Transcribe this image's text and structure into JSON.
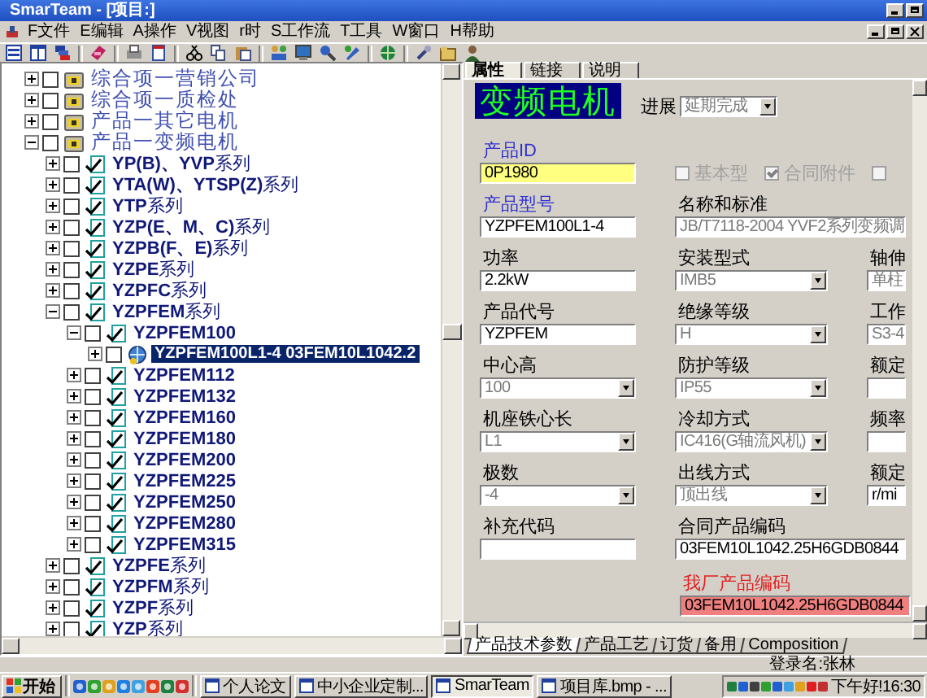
{
  "window": {
    "title": "SmarTeam - [项目:]"
  },
  "menu": [
    "F文件",
    "E编辑",
    "A操作",
    "V视图",
    "r时",
    "S工作流",
    "T工具",
    "W窗口",
    "H帮助"
  ],
  "tree": [
    {
      "kind": "group",
      "label": "综合项一营销公司",
      "expanded": false,
      "checked": false,
      "selected": false
    },
    {
      "kind": "group",
      "label": "综合项一质检处",
      "expanded": false,
      "checked": false,
      "selected": false
    },
    {
      "kind": "group",
      "label": "产品一其它电机",
      "expanded": false,
      "checked": false,
      "selected": false
    },
    {
      "kind": "group",
      "label": "产品一变频电机",
      "expanded": true,
      "checked": false,
      "selected": false,
      "children": [
        {
          "kind": "series",
          "label": "**YP(B)、YVP**系列",
          "expanded": false,
          "checked": false,
          "selected": false
        },
        {
          "kind": "series",
          "label": "**YTA(W)、YTSP(Z)**系列",
          "expanded": false,
          "checked": false,
          "selected": false
        },
        {
          "kind": "series",
          "label": "**YTP**系列",
          "expanded": false,
          "checked": false,
          "selected": false
        },
        {
          "kind": "series",
          "label": "**YZP(E、M、C)**系列",
          "expanded": false,
          "checked": false,
          "selected": false
        },
        {
          "kind": "series",
          "label": "**YZPB(F、E)**系列",
          "expanded": false,
          "checked": false,
          "selected": false
        },
        {
          "kind": "series",
          "label": "**YZPE**系列",
          "expanded": false,
          "checked": false,
          "selected": false
        },
        {
          "kind": "series",
          "label": "**YZPFC**系列",
          "expanded": false,
          "checked": false,
          "selected": false
        },
        {
          "kind": "series",
          "label": "**YZPFEM**系列",
          "expanded": true,
          "checked": false,
          "selected": false,
          "children": [
            {
              "kind": "model",
              "label": "YZPFEM100",
              "expanded": true,
              "checked": false,
              "selected": false,
              "children": [
                {
                  "kind": "product",
                  "label": "YZPFEM100L1-4 03FEM10L1042.2",
                  "expanded": false,
                  "checked": false,
                  "selected": true
                }
              ]
            },
            {
              "kind": "model",
              "label": "YZPFEM112",
              "expanded": false,
              "checked": false,
              "selected": false
            },
            {
              "kind": "model",
              "label": "YZPFEM132",
              "expanded": false,
              "checked": false,
              "selected": false
            },
            {
              "kind": "model",
              "label": "YZPFEM160",
              "expanded": false,
              "checked": false,
              "selected": false
            },
            {
              "kind": "model",
              "label": "YZPFEM180",
              "expanded": false,
              "checked": false,
              "selected": false
            },
            {
              "kind": "model",
              "label": "YZPFEM200",
              "expanded": false,
              "checked": false,
              "selected": false
            },
            {
              "kind": "model",
              "label": "YZPFEM225",
              "expanded": false,
              "checked": false,
              "selected": false
            },
            {
              "kind": "model",
              "label": "YZPFEM250",
              "expanded": false,
              "checked": false,
              "selected": false
            },
            {
              "kind": "model",
              "label": "YZPFEM280",
              "expanded": false,
              "checked": false,
              "selected": false
            },
            {
              "kind": "model",
              "label": "YZPFEM315",
              "expanded": false,
              "checked": false,
              "selected": false
            }
          ]
        },
        {
          "kind": "series",
          "label": "**YZPFE**系列",
          "expanded": false,
          "checked": false,
          "selected": false
        },
        {
          "kind": "series",
          "label": "**YZPFM**系列",
          "expanded": false,
          "checked": false,
          "selected": false
        },
        {
          "kind": "series",
          "label": "**YZPF**系列",
          "expanded": false,
          "checked": false,
          "selected": false
        },
        {
          "kind": "series",
          "label": "**YZP**系列",
          "expanded": false,
          "checked": false,
          "selected": false
        }
      ]
    }
  ],
  "details": {
    "tabs": [
      {
        "label": "属性",
        "selected": true
      },
      {
        "label": "链接",
        "selected": false
      },
      {
        "label": "说明",
        "selected": false
      }
    ],
    "heading": "变频电机",
    "progress": {
      "label": "进展",
      "value": "延期完成",
      "disabled": true
    },
    "form_rows": [
      {
        "cells": [
          {
            "kind": "field",
            "label": "产品ID",
            "color": "#3030d0",
            "field": {
              "kind": "text",
              "value": "0P1980",
              "disabled": false,
              "color": "#ffff80"
            }
          },
          {
            "kind": "checkboxes",
            "disabled": true,
            "items": [
              {
                "label": "基本型",
                "checked": false
              },
              {
                "label": "合同附件",
                "checked": true
              },
              {
                "checked": false
              }
            ]
          }
        ]
      },
      {
        "cells": [
          {
            "kind": "field",
            "label": "产品型号",
            "color": "#3030d0",
            "field": {
              "kind": "text",
              "value": "YZPFEM100L1-4",
              "disabled": false
            }
          },
          {
            "kind": "field",
            "label": "名称和标准",
            "field": {
              "kind": "text",
              "value": "JB/T7118-2004 YVF2系列变频调",
              "disabled": true
            }
          }
        ]
      },
      {
        "cells": [
          {
            "kind": "field",
            "label": "功率",
            "field": {
              "kind": "text",
              "value": "2.2kW",
              "disabled": false
            }
          },
          {
            "kind": "field",
            "label": "安装型式",
            "field": {
              "kind": "dropdown",
              "value": "IMB5",
              "disabled": true
            }
          },
          {
            "kind": "field",
            "label": "轴伸",
            "field": {
              "kind": "text",
              "value": "单柱",
              "disabled": true
            }
          }
        ]
      },
      {
        "cells": [
          {
            "kind": "field",
            "label": "产品代号",
            "field": {
              "kind": "text",
              "value": "YZPFEM",
              "disabled": false
            }
          },
          {
            "kind": "field",
            "label": "绝缘等级",
            "field": {
              "kind": "dropdown",
              "value": "H",
              "disabled": true
            }
          },
          {
            "kind": "field",
            "label": "工作",
            "field": {
              "kind": "text",
              "value": "S3-4",
              "disabled": true
            }
          }
        ]
      },
      {
        "cells": [
          {
            "kind": "field",
            "label": "中心高",
            "field": {
              "kind": "dropdown",
              "value": "100",
              "disabled": true
            }
          },
          {
            "kind": "field",
            "label": "防护等级",
            "field": {
              "kind": "dropdown",
              "value": "IP55",
              "disabled": true
            }
          },
          {
            "kind": "field",
            "label": "额定",
            "field": {
              "kind": "text"
            }
          }
        ]
      },
      {
        "cells": [
          {
            "kind": "field",
            "label": "机座铁心长",
            "field": {
              "kind": "dropdown",
              "value": "L1",
              "disabled": true
            }
          },
          {
            "kind": "field",
            "label": "冷却方式",
            "field": {
              "kind": "dropdown",
              "value": "IC416(G轴流风机)",
              "disabled": true
            }
          },
          {
            "kind": "field",
            "label": "频率",
            "field": {
              "kind": "text"
            }
          }
        ]
      },
      {
        "cells": [
          {
            "kind": "field",
            "label": "极数",
            "field": {
              "kind": "dropdown",
              "value": "-4",
              "disabled": true
            }
          },
          {
            "kind": "field",
            "label": "出线方式",
            "field": {
              "kind": "dropdown",
              "value": "顶出线",
              "disabled": true
            }
          },
          {
            "kind": "field",
            "label": "额定",
            "field": {
              "kind": "text",
              "value": "r/mi",
              "disabled": false
            }
          }
        ]
      },
      {
        "cells": [
          {
            "kind": "field",
            "label": "补充代码",
            "field": {
              "kind": "text"
            }
          },
          {
            "kind": "field",
            "label": "合同产品编码",
            "field": {
              "kind": "text",
              "value": "03FEM10L1042.25H6GDB0844",
              "disabled": false
            }
          }
        ]
      }
    ],
    "factory_code": {
      "label": "我厂产品编码",
      "color": "#e02020",
      "field": {
        "kind": "text",
        "value": "03FEM10L1042.25H6GDB0844",
        "disabled": false,
        "color": "#f08080"
      }
    },
    "bottom_tabs": [
      {
        "label": "产品技术参数",
        "selected": true
      },
      {
        "label": "产品工艺",
        "selected": false
      },
      {
        "label": "订货",
        "selected": false
      },
      {
        "label": "备用",
        "selected": false
      },
      {
        "label": "Composition",
        "selected": false
      }
    ]
  },
  "status_bar": {
    "login": "登录名:张林"
  },
  "taskbar": {
    "start": "开始",
    "tasks": [
      {
        "label": "个人论文",
        "selected": false
      },
      {
        "label": "中小企业定制...",
        "selected": false
      },
      {
        "label": "SmarTeam",
        "selected": true
      },
      {
        "label": "项目库.bmp - ...",
        "selected": false
      }
    ],
    "clock": "下午好!16:30"
  }
}
